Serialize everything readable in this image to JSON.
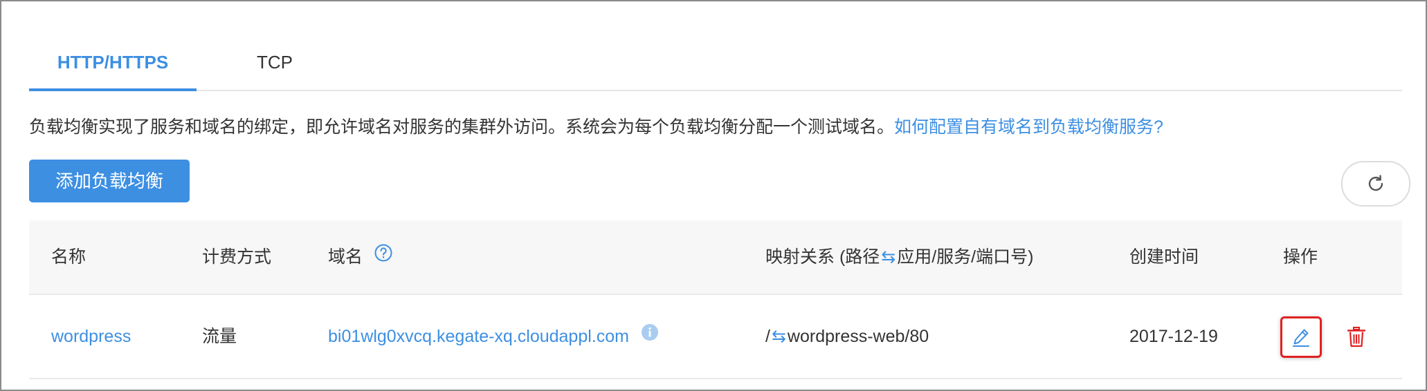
{
  "tabs": [
    {
      "label": "HTTP/HTTPS",
      "active": true
    },
    {
      "label": "TCP",
      "active": false
    }
  ],
  "description": {
    "text": "负载均衡实现了服务和域名的绑定，即允许域名对服务的集群外访问。系统会为每个负载均衡分配一个测试域名。",
    "link": "如何配置自有域名到负载均衡服务?"
  },
  "add_button": {
    "label": "添加负载均衡"
  },
  "table": {
    "headers": {
      "name": "名称",
      "billing": "计费方式",
      "domain": "域名",
      "mapping_prefix": "映射关系 (路径",
      "mapping_swap": "⇆",
      "mapping_suffix": "应用/服务/端口号)",
      "created": "创建时间",
      "actions": "操作"
    },
    "rows": [
      {
        "name": "wordpress",
        "billing": "流量",
        "domain": "bi01wlg0xvcq.kegate-xq.cloudappl.com",
        "mapping_path": "/",
        "mapping_swap": "⇆",
        "mapping_target": "wordpress-web/80",
        "created": "2017-12-19"
      }
    ]
  },
  "icons": {
    "refresh": "refresh-icon",
    "help": "help-circle-icon",
    "info": "info-circle-icon",
    "edit": "pencil-icon",
    "delete": "trash-icon"
  },
  "colors": {
    "accent": "#3d8fe2",
    "danger": "#e02020",
    "header_bg": "#f7f7f7"
  }
}
